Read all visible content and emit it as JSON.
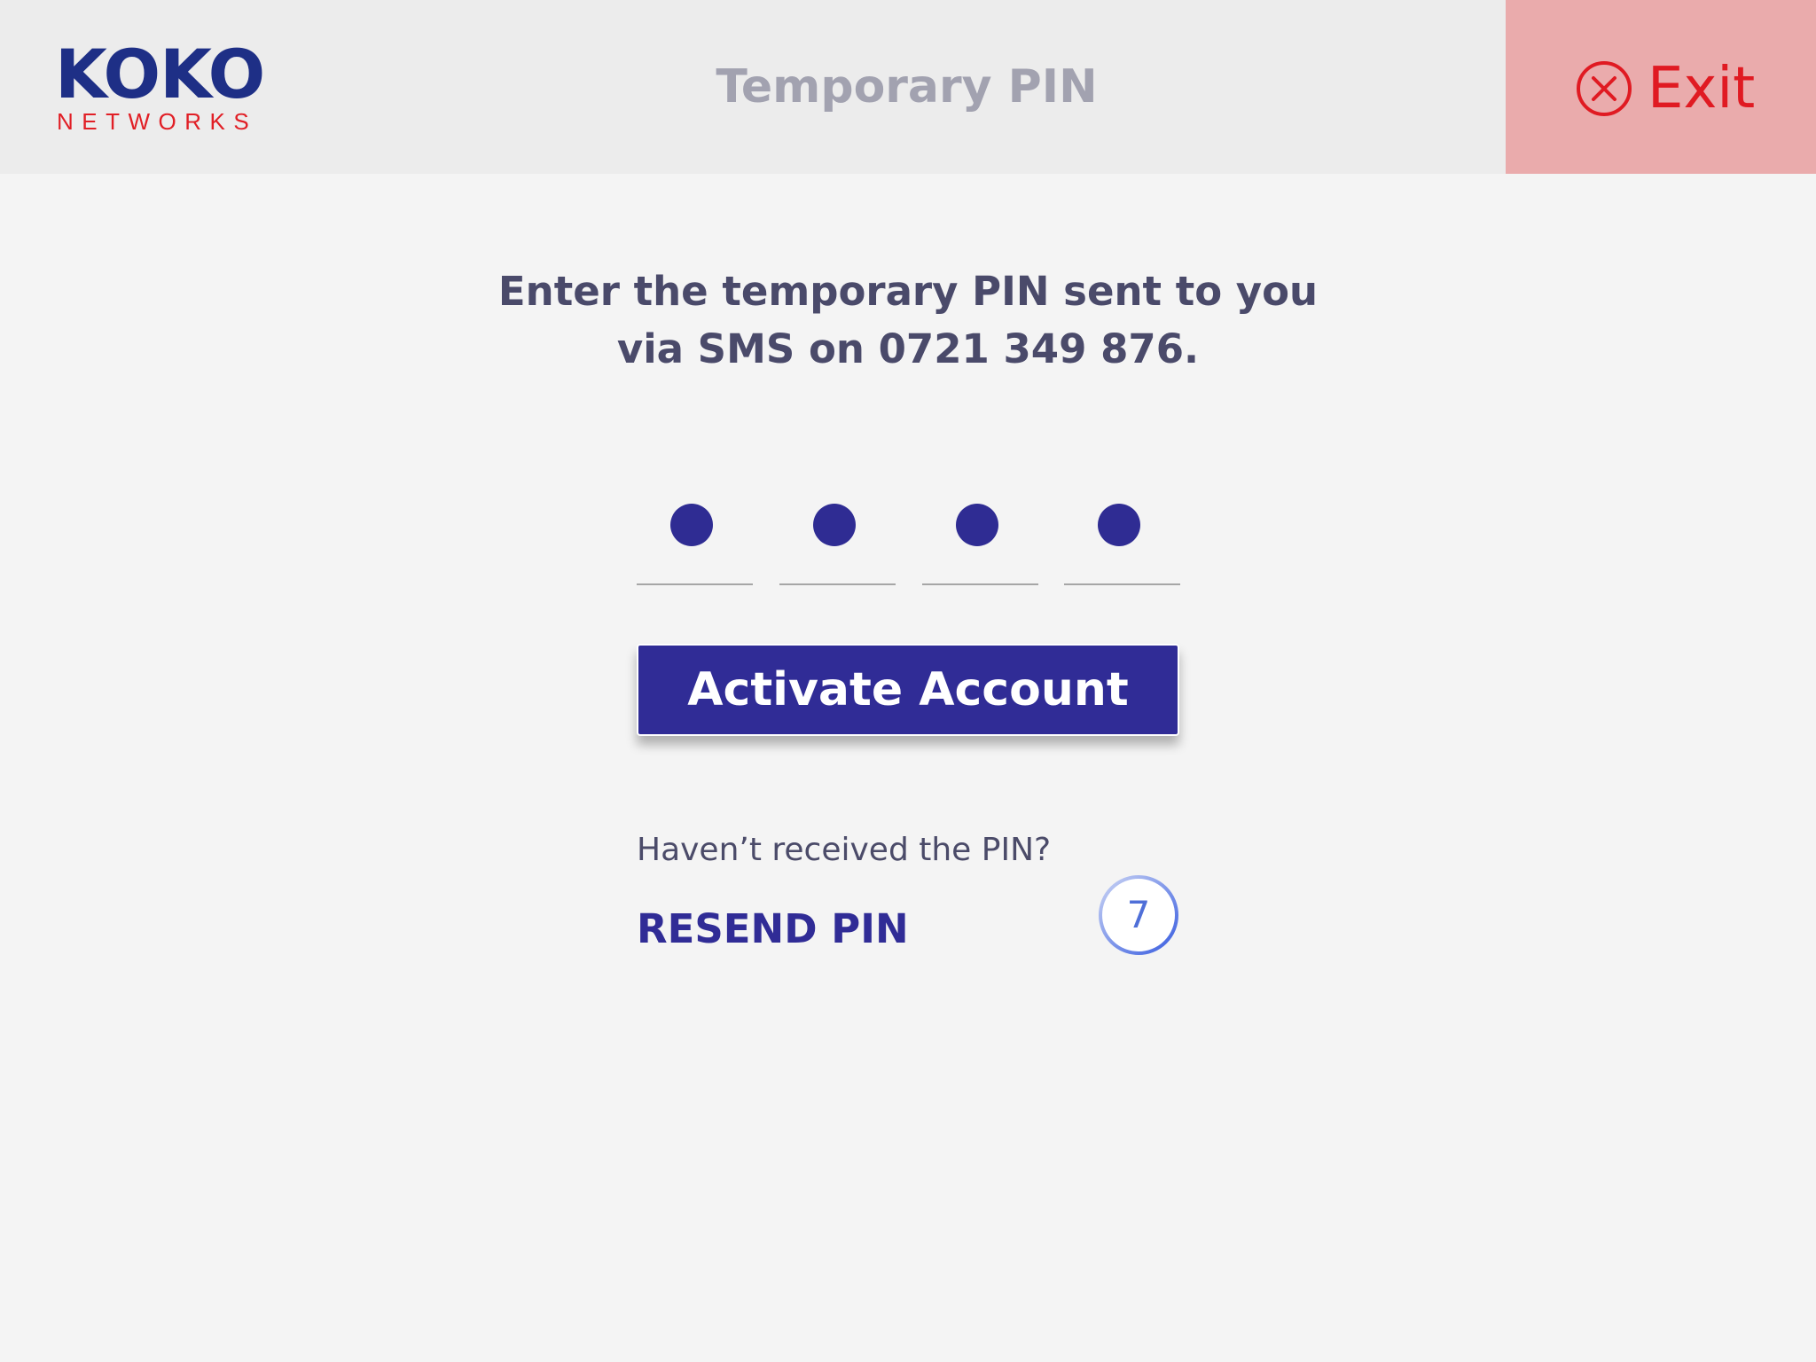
{
  "header": {
    "logo_main": "KOKO",
    "logo_sub": "NETWORKS",
    "title": "Temporary PIN",
    "exit_label": "Exit"
  },
  "instruction": {
    "line1": "Enter the temporary PIN sent to you",
    "line2": "via SMS on 0721 349 876."
  },
  "pin": {
    "length": 4,
    "filled": 4
  },
  "activate_label": "Activate Account",
  "resend": {
    "question": "Haven’t received the PIN?",
    "link_label": "RESEND PIN",
    "countdown": "7"
  },
  "colors": {
    "brand_blue": "#302c96",
    "logo_red": "#e11f26",
    "exit_bg": "#eaabac",
    "exit_red": "#e01a22",
    "countdown_blue": "#4f6fd8"
  },
  "icons": {
    "exit": "close-circle-icon"
  }
}
